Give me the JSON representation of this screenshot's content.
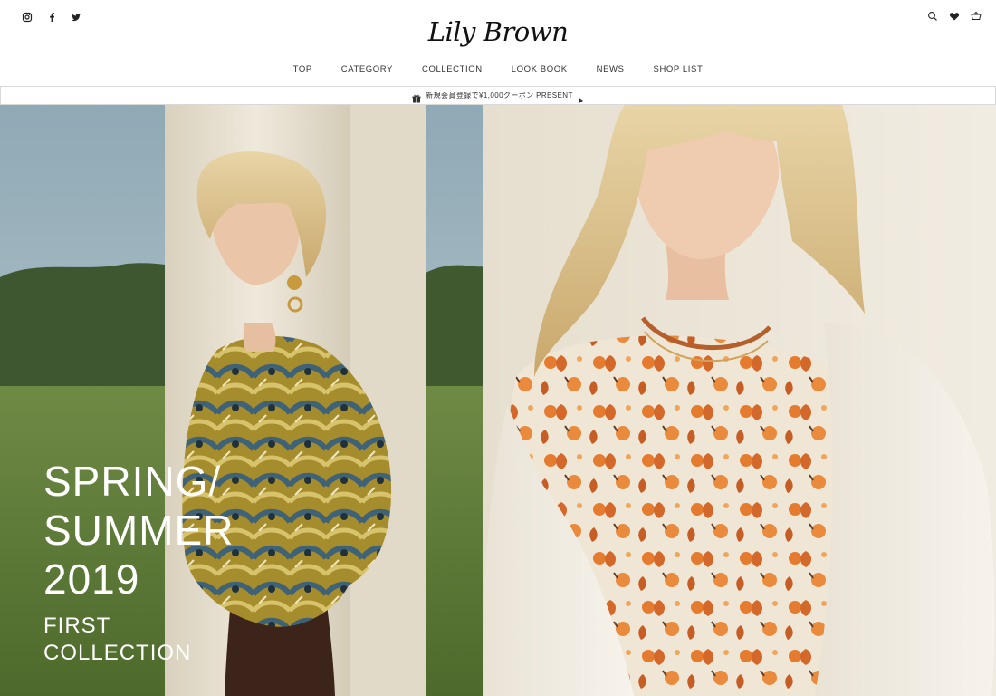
{
  "header": {
    "social_icons": [
      "instagram-icon",
      "facebook-icon",
      "twitter-icon"
    ],
    "utility_icons": [
      "search-icon",
      "heart-icon",
      "cart-icon"
    ],
    "logo": "Lily Brown"
  },
  "nav": {
    "items": [
      "TOP",
      "CATEGORY",
      "COLLECTION",
      "LOOK BOOK",
      "NEWS",
      "SHOP LIST"
    ]
  },
  "banner": {
    "icon": "gift-icon",
    "text": "新規会員登録で¥1,000クーポン PRESENT"
  },
  "hero": {
    "line1": "SPRING/",
    "line2": "SUMMER",
    "line3": "2019",
    "sub1": "FIRST",
    "sub2": "COLLECTION"
  },
  "colors": {
    "text": "#333333",
    "logo": "#111111",
    "banner_border": "#d9d9d9",
    "sky": "#9fb7c4",
    "grass": "#5f7d3a",
    "pillar": "#e9e3d3",
    "headline": "#ffffff"
  }
}
